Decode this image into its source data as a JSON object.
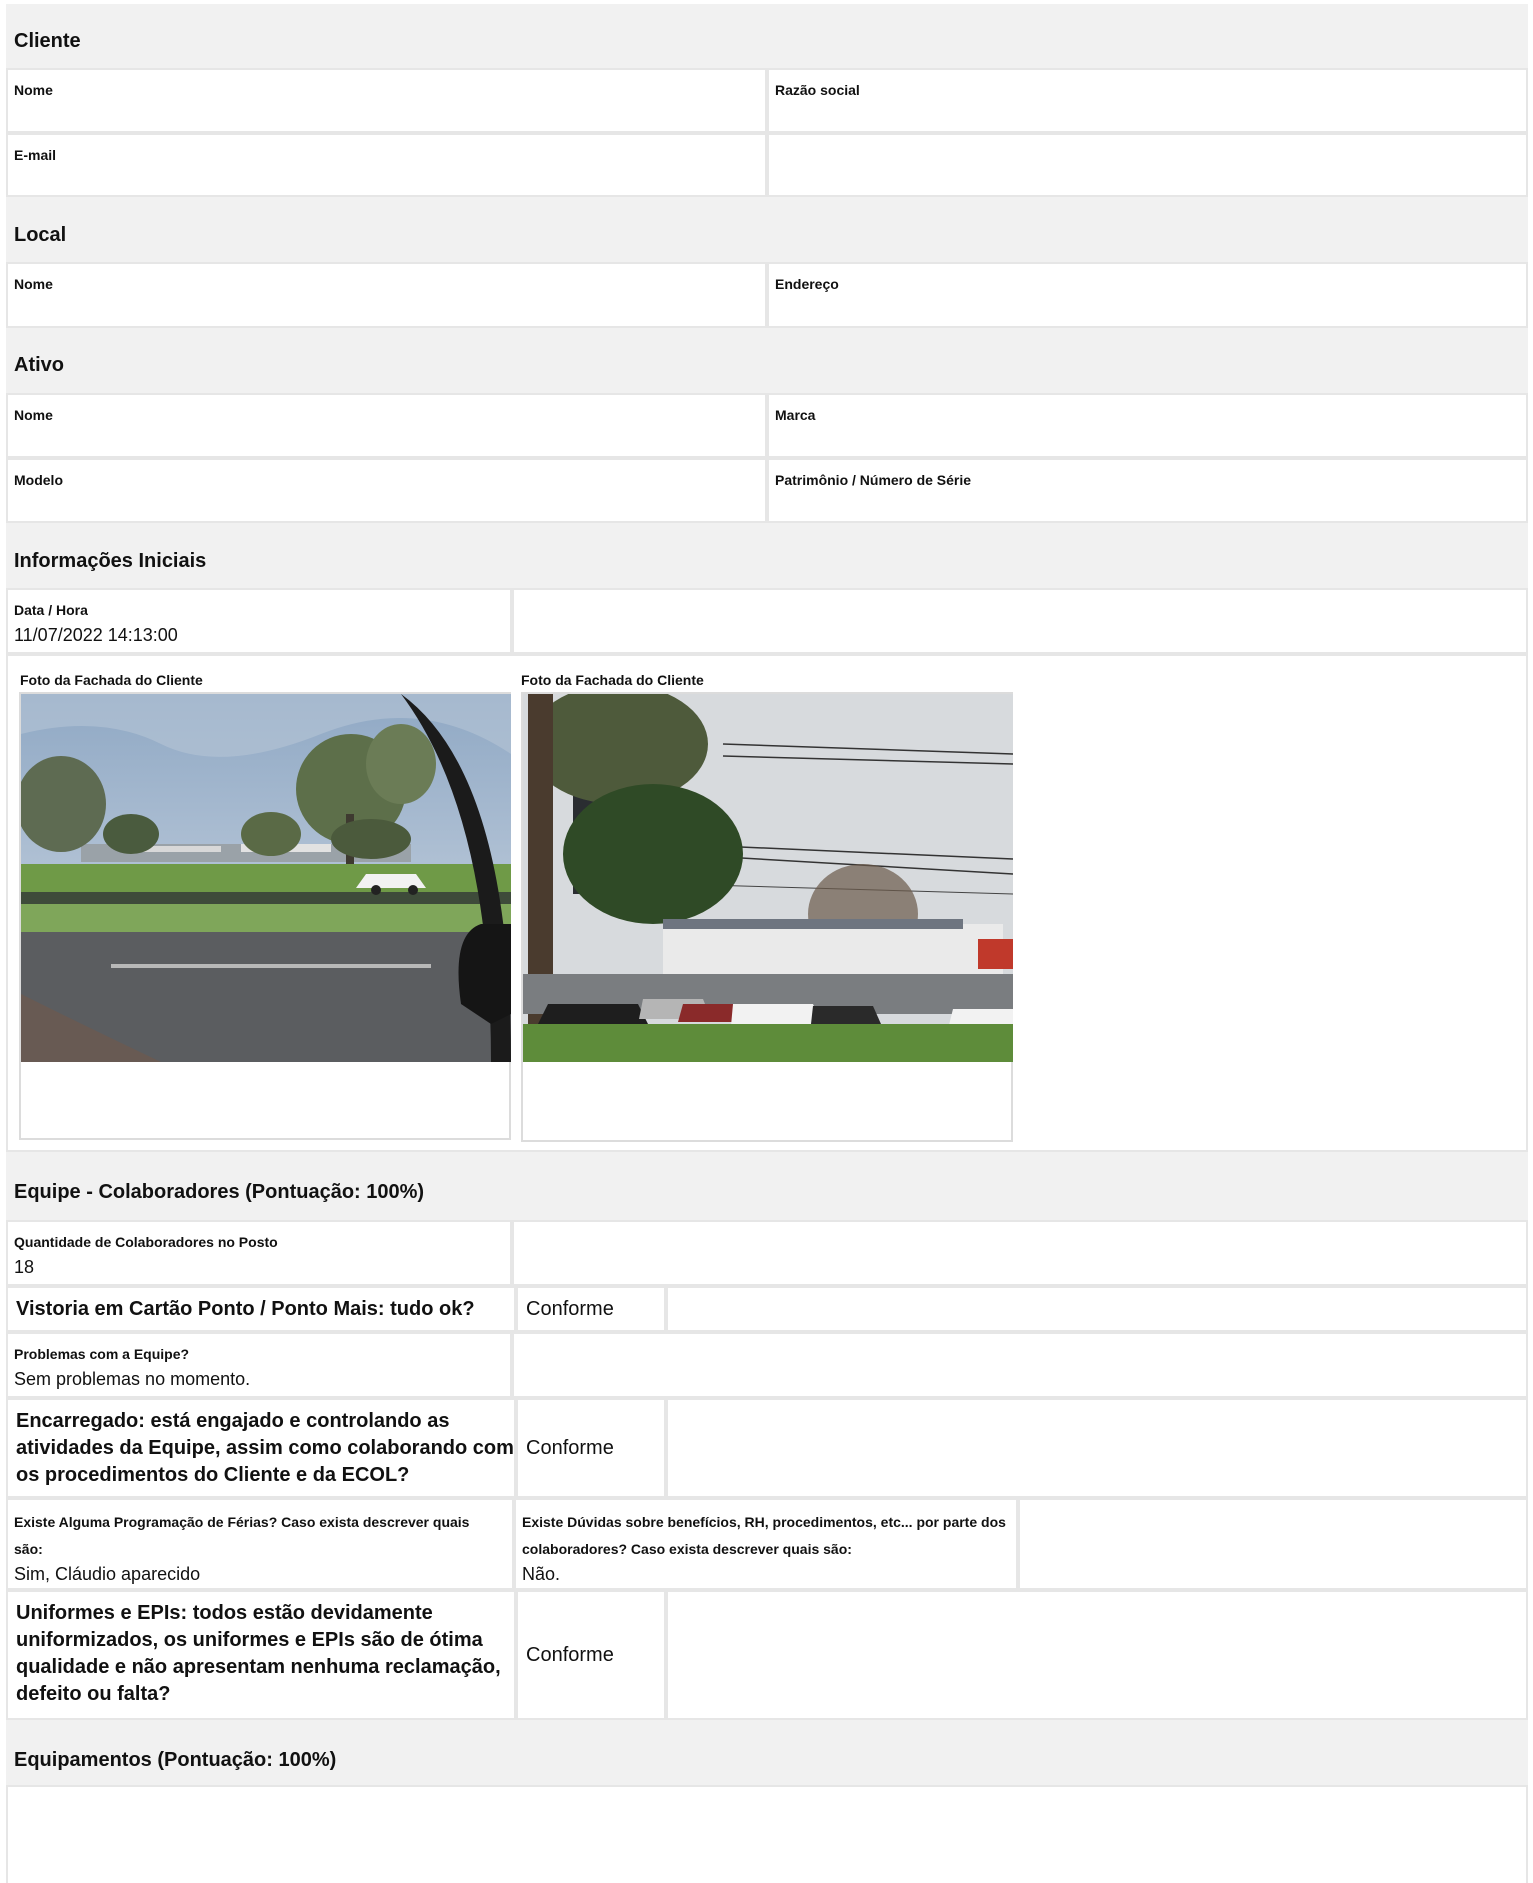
{
  "cliente": {
    "title": "Cliente",
    "nome_label": "Nome",
    "razao_label": "Razão social",
    "email_label": "E-mail"
  },
  "local": {
    "title": "Local",
    "nome_label": "Nome",
    "endereco_label": "Endereço"
  },
  "ativo": {
    "title": "Ativo",
    "nome_label": "Nome",
    "marca_label": "Marca",
    "modelo_label": "Modelo",
    "patrimonio_label": "Patrimônio / Número de Série"
  },
  "info": {
    "title": "Informações Iniciais",
    "datahora_label": "Data / Hora",
    "datahora_value": "11/07/2022 14:13:00",
    "foto1_label": "Foto da Fachada do Cliente",
    "foto2_label": "Foto da Fachada do Cliente"
  },
  "equipe": {
    "title": "Equipe - Colaboradores (Pontuação: 100%)",
    "qtd_label": "Quantidade de Colaboradores no Posto",
    "qtd_value": "18",
    "vistoria_q": "Vistoria em Cartão Ponto / Ponto Mais: tudo ok?",
    "vistoria_a": "Conforme",
    "problemas_label": "Problemas com a Equipe?",
    "problemas_value": "Sem problemas no momento.",
    "encarregado_q1": "Encarregado: está engajado e controlando as",
    "encarregado_q2": "atividades da Equipe, assim como colaborando com",
    "encarregado_q3": "os procedimentos do Cliente e da ECOL?",
    "encarregado_a": "Conforme",
    "ferias_label1": "Existe Alguma Programação de Férias? Caso exista descrever quais",
    "ferias_label2": "são:",
    "ferias_value": "Sim, Cláudio aparecido",
    "duvidas_label1": "Existe Dúvidas sobre benefícios, RH, procedimentos, etc... por parte dos",
    "duvidas_label2": "colaboradores? Caso exista descrever quais são:",
    "duvidas_value": "Não.",
    "uniformes_q1": "Uniformes e EPIs: todos estão devidamente",
    "uniformes_q2": "uniformizados, os uniformes e EPIs são de ótima",
    "uniformes_q3": "qualidade e não apresentam nenhuma reclamação,",
    "uniformes_q4": "defeito ou falta?",
    "uniformes_a": "Conforme"
  },
  "equipamentos": {
    "title": "Equipamentos (Pontuação: 100%)"
  }
}
